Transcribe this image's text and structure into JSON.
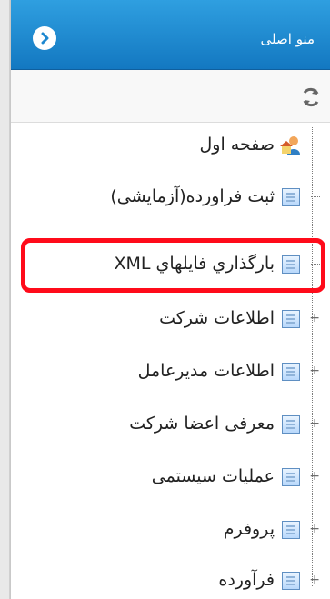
{
  "header": {
    "title": "منو اصلی"
  },
  "tree": {
    "items": [
      {
        "label": "صفحه اول",
        "icon": "home-user-icon",
        "expandable": false
      },
      {
        "label": "ثبت فراورده(آزمایشی)",
        "icon": "document-icon",
        "expandable": false
      },
      {
        "label": "بارگذاري فايلهاي XML",
        "icon": "document-icon",
        "expandable": false,
        "highlighted": true
      },
      {
        "label": "اطلاعات شرکت",
        "icon": "document-icon",
        "expandable": true
      },
      {
        "label": "اطلاعات مدیرعامل",
        "icon": "document-icon",
        "expandable": true
      },
      {
        "label": "معرفی اعضا شرکت",
        "icon": "document-icon",
        "expandable": true
      },
      {
        "label": "عملیات سیستمی",
        "icon": "document-icon",
        "expandable": true
      },
      {
        "label": "پروفرم",
        "icon": "document-icon",
        "expandable": true
      },
      {
        "label": "فرآورده",
        "icon": "document-icon",
        "expandable": true
      }
    ]
  },
  "colors": {
    "header_top": "#2f9fe0",
    "header_bottom": "#1378c1",
    "highlight": "#ff0b1a"
  }
}
